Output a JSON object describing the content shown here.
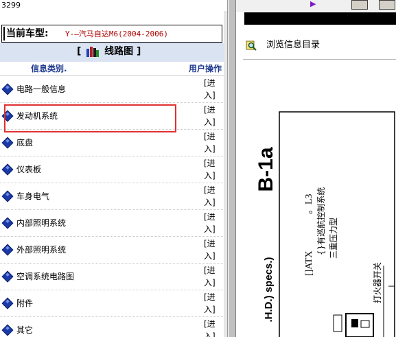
{
  "window": {
    "id_label": "3299"
  },
  "vehicle": {
    "label": "当前车型:",
    "value": "Y-—汽马自达M6(2004-2006)"
  },
  "section": {
    "open_bracket": "[",
    "title": "线路图",
    "close_bracket": "]"
  },
  "columns": {
    "category": "信息类别.",
    "action": "用户操作"
  },
  "rows": [
    {
      "label": "电路一般信息",
      "enter_top": "[进",
      "enter_bottom": "入]"
    },
    {
      "label": "发动机系统",
      "enter_top": "[进",
      "enter_bottom": "入]"
    },
    {
      "label": "底盘",
      "enter_top": "[进",
      "enter_bottom": "入]"
    },
    {
      "label": "仪表板",
      "enter_top": "[进",
      "enter_bottom": "入]"
    },
    {
      "label": "车身电气",
      "enter_top": "[进",
      "enter_bottom": "入]"
    },
    {
      "label": "内部照明系统",
      "enter_top": "[进",
      "enter_bottom": "入]"
    },
    {
      "label": "外部照明系统",
      "enter_top": "[进",
      "enter_bottom": "入]"
    },
    {
      "label": "空调系统电路图",
      "enter_top": "[进",
      "enter_bottom": "入]"
    },
    {
      "label": "附件",
      "enter_top": "[进",
      "enter_bottom": "入]"
    },
    {
      "label": "其它",
      "enter_top": "[进",
      "enter_bottom": "入]"
    }
  ],
  "right": {
    "browse_label": "浏览信息目录",
    "diagram": {
      "page_id": "B-1a",
      "line1": "[]ATX",
      "line1b": "。L3",
      "line2": "{}有巡航控制系统",
      "line3": "三重压力型",
      "line4": "打火器开关",
      "spec_text": ".H.D.) specs.)"
    }
  },
  "colors": {
    "highlight": "#e03030",
    "vehicle_value": "#b00000",
    "header_text": "#1f3a8f",
    "section_bg": "#d9e3f2",
    "diamond": "#1b3aa8"
  },
  "icons": [
    "books-icon",
    "diamond-bullet-icon",
    "browse-catalog-icon",
    "nav-arrow-icon"
  ]
}
